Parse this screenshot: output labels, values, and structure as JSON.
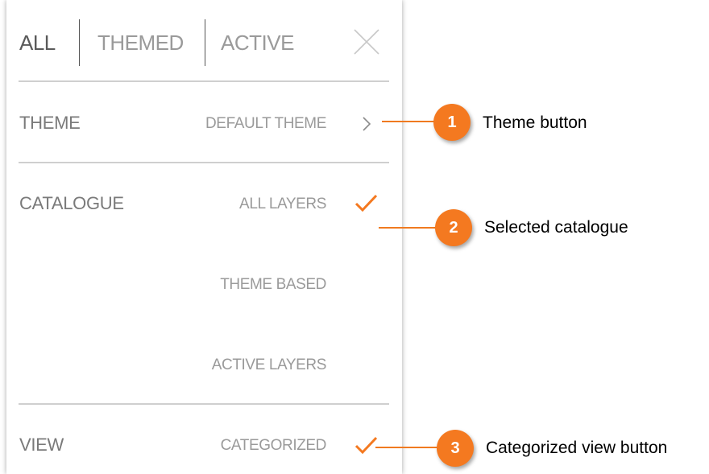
{
  "tabs": [
    {
      "label": "ALL"
    },
    {
      "label": "THEMED"
    },
    {
      "label": "ACTIVE"
    }
  ],
  "theme": {
    "label": "THEME",
    "value": "DEFAULT THEME"
  },
  "catalogue": {
    "label": "CATALOGUE",
    "options": [
      {
        "label": "ALL LAYERS",
        "selected": true
      },
      {
        "label": "THEME BASED",
        "selected": false
      },
      {
        "label": "ACTIVE LAYERS",
        "selected": false
      }
    ]
  },
  "view": {
    "label": "VIEW",
    "value": "CATEGORIZED",
    "selected": true
  },
  "callouts": [
    {
      "number": "1",
      "text": "Theme button"
    },
    {
      "number": "2",
      "text": "Selected catalogue"
    },
    {
      "number": "3",
      "text": "Categorized view button"
    }
  ],
  "colors": {
    "accent": "#f47920",
    "text_primary": "#5a5a5a",
    "text_muted": "#9a9a9a"
  },
  "icons": [
    "close-icon",
    "chevron-right-icon",
    "checkmark-icon"
  ]
}
